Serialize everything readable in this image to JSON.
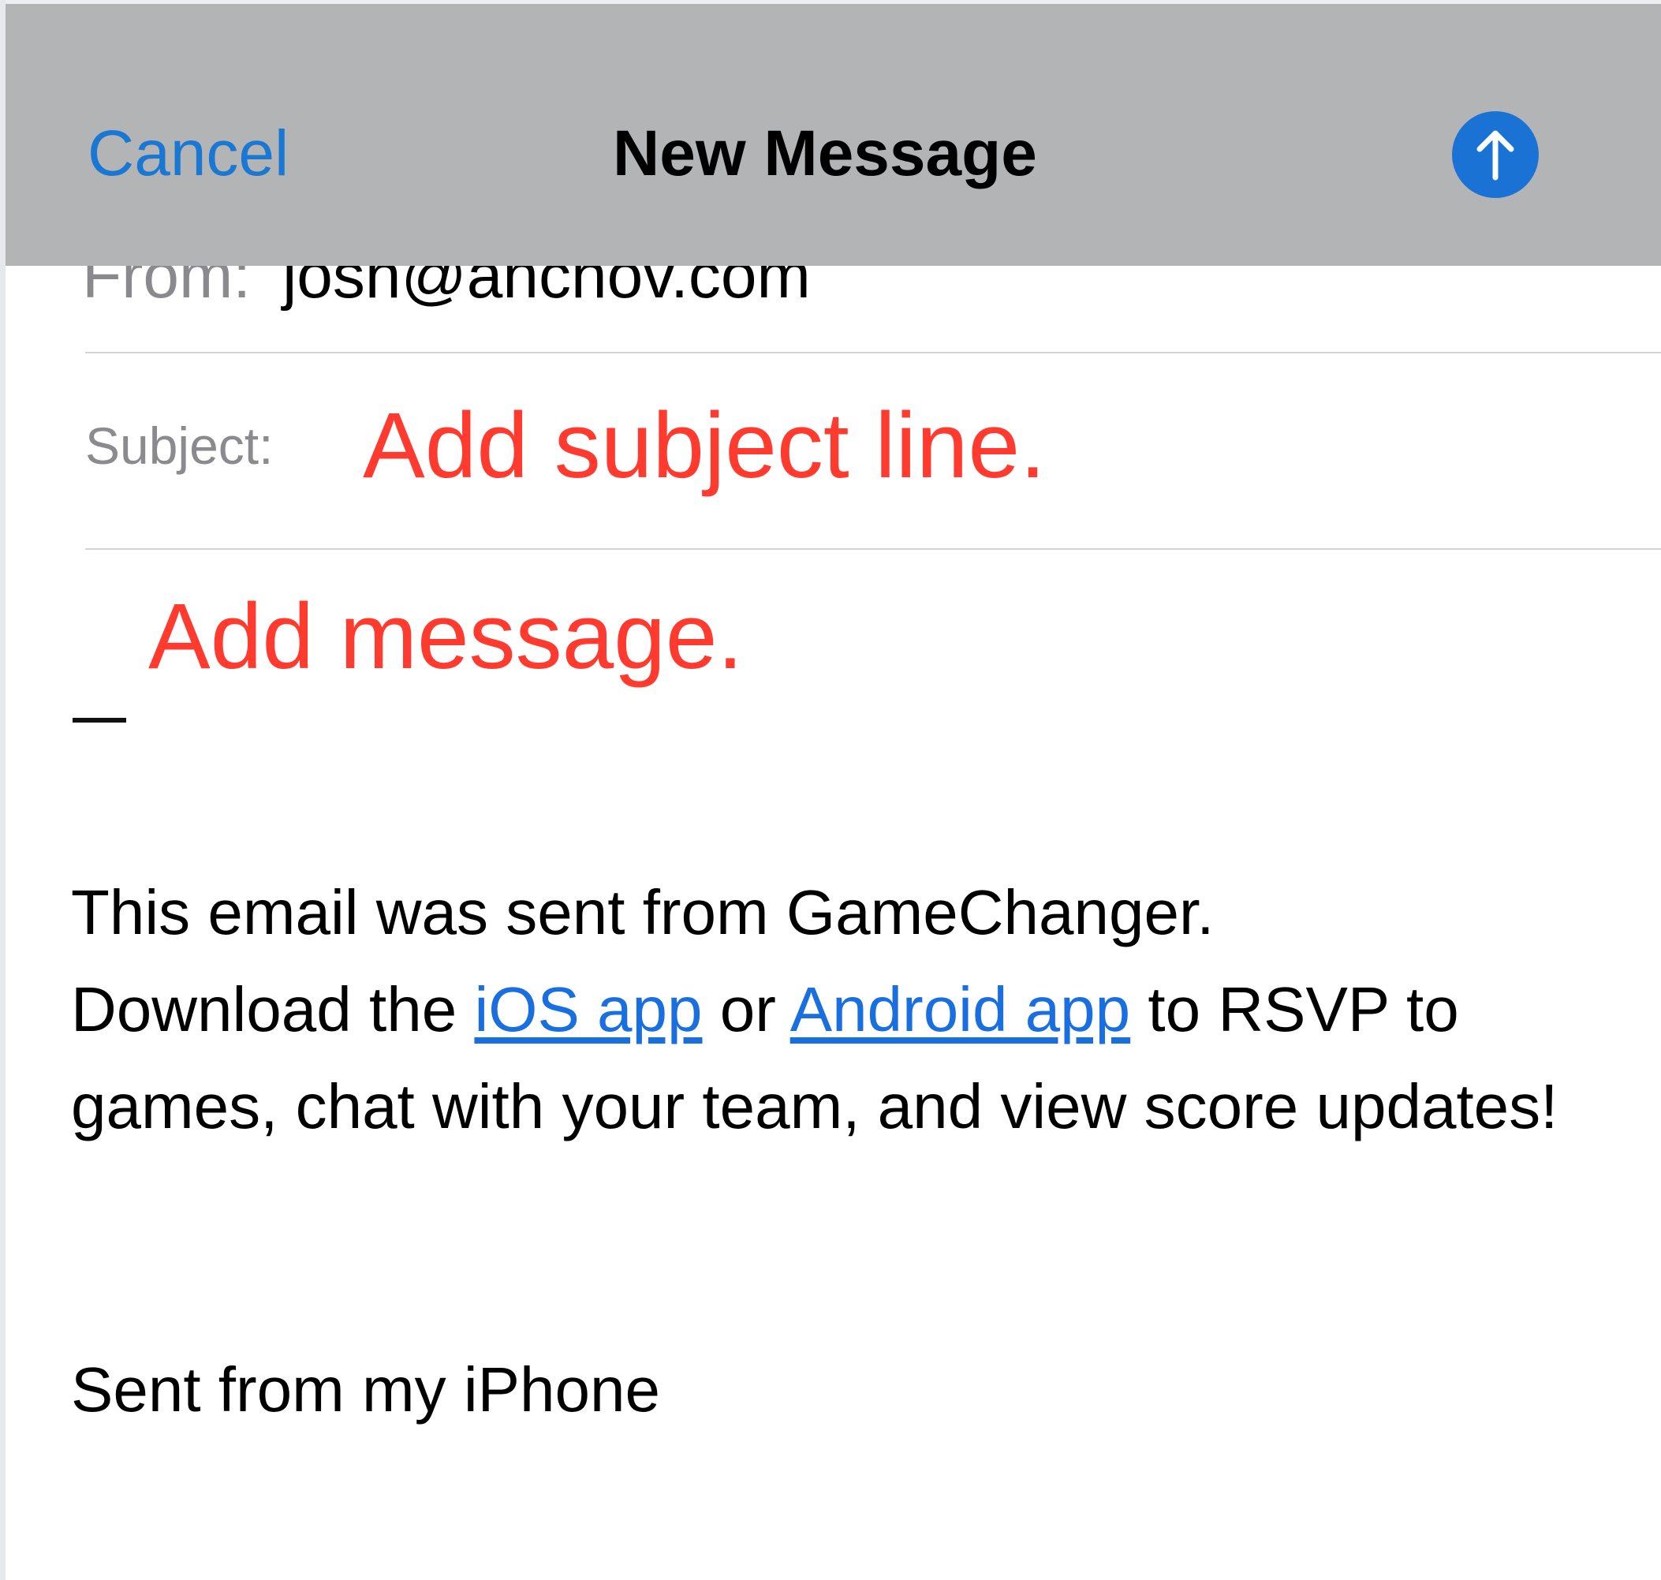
{
  "navbar": {
    "cancel_label": "Cancel",
    "title": "New Message",
    "send_icon": "arrow-up-icon",
    "background_color": "#b3b4b6",
    "accent_color": "#1a77d2"
  },
  "from": {
    "label": "From:",
    "value": "josh@anchov.com"
  },
  "subject": {
    "label": "Subject:",
    "value": "Add subject line."
  },
  "message": {
    "placeholder": "Add message."
  },
  "body": {
    "line1": "This email was sent from GameChanger.",
    "prefix": "Download the",
    "ios_link": "iOS app",
    "connector": "or",
    "android_link": "Android app",
    "suffix": "to RSVP to games, chat with your team, and view score updates!",
    "link_color": "#1a6fe0"
  },
  "signature": "Sent from my iPhone",
  "annotation_color": "#ff3b30"
}
